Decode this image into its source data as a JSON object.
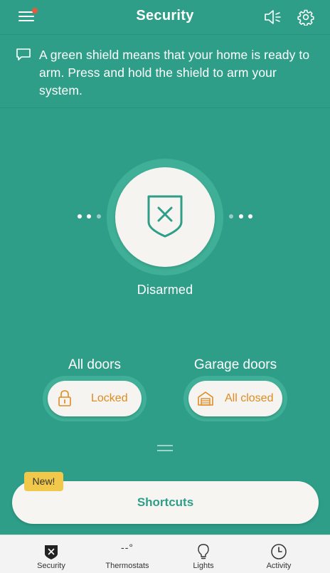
{
  "header": {
    "title": "Security",
    "menu_icon": "hamburger-menu-icon",
    "notification_dot_color": "#e8593c",
    "speaker_icon": "speaker-muted-icon",
    "settings_icon": "gear-icon"
  },
  "banner": {
    "icon": "chat-bubble-icon",
    "text": "A green shield means that your home is ready to arm. Press and hold the shield to arm your system."
  },
  "arm_control": {
    "icon": "shield-x-icon",
    "state": "Disarmed"
  },
  "doors": {
    "all_doors": {
      "label": "All doors",
      "status": "Locked",
      "icon": "lock-icon"
    },
    "garage_doors": {
      "label": "Garage doors",
      "status": "All closed",
      "icon": "garage-icon"
    }
  },
  "shortcuts": {
    "badge": "New!",
    "label": "Shortcuts"
  },
  "tabs": [
    {
      "label": "Security",
      "icon": "shield-icon",
      "selected": true
    },
    {
      "label": "Thermostats",
      "icon": "thermostat-icon",
      "value": "--°"
    },
    {
      "label": "Lights",
      "icon": "lightbulb-icon"
    },
    {
      "label": "Activity",
      "icon": "clock-icon"
    }
  ],
  "colors": {
    "background": "#2e9e88",
    "accent_orange": "#e08b22",
    "card": "#f6f4f0",
    "badge": "#f2c84b"
  }
}
